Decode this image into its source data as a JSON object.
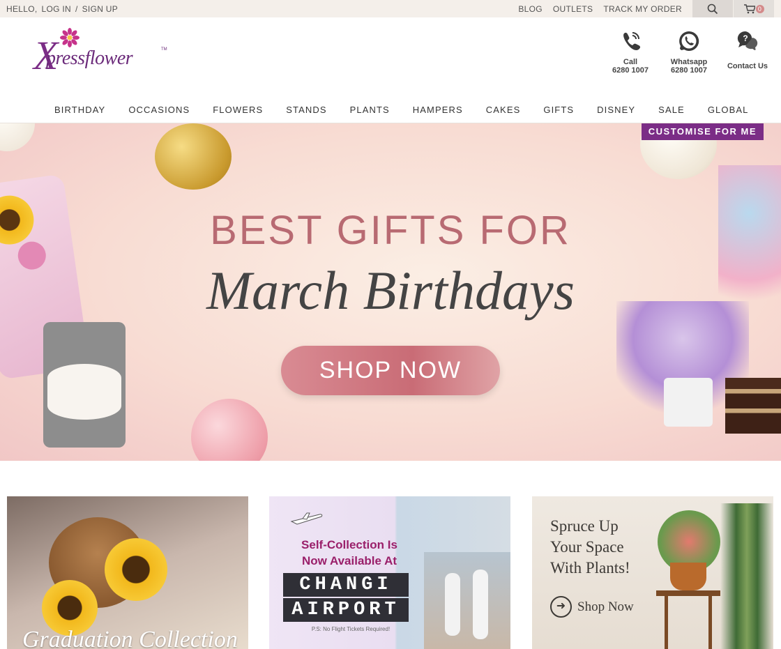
{
  "topbar": {
    "hello": "HELLO,",
    "login": "LOG IN",
    "sep": "/",
    "signup": "SIGN UP",
    "links": [
      "BLOG",
      "OUTLETS",
      "TRACK MY ORDER"
    ],
    "cart_count": "0",
    "icons": {
      "search": "search-icon",
      "cart": "cart-icon"
    }
  },
  "header": {
    "logo_x": "X",
    "logo_text": "pressflower",
    "logo_tm": "TM",
    "contacts": [
      {
        "title": "Call",
        "sub": "6280 1007",
        "icon": "phone-icon"
      },
      {
        "title": "Whatsapp",
        "sub": "6280 1007",
        "icon": "whatsapp-icon"
      },
      {
        "title": "Contact Us",
        "sub": "",
        "icon": "chat-icon"
      }
    ]
  },
  "nav": [
    "BIRTHDAY",
    "OCCASIONS",
    "FLOWERS",
    "STANDS",
    "PLANTS",
    "HAMPERS",
    "CAKES",
    "GIFTS",
    "DISNEY",
    "SALE",
    "GLOBAL"
  ],
  "hero": {
    "customise": "CUSTOMISE FOR ME",
    "line1": "BEST GIFTS FOR",
    "line2": "March Birthdays",
    "cta": "SHOP NOW",
    "colors": {
      "accent": "#7b2d86",
      "title": "#b86a72"
    }
  },
  "cards": {
    "graduation": {
      "title": "Graduation Collection"
    },
    "changi": {
      "line1": "Self-Collection Is",
      "line2": "Now Available At",
      "line3": "CHANGI",
      "line4": "AIRPORT",
      "note": "P.S: No Flight Tickets Required!"
    },
    "plants": {
      "line1": "Spruce Up",
      "line2": "Your Space",
      "line3": "With Plants!",
      "cta": "Shop Now"
    }
  }
}
